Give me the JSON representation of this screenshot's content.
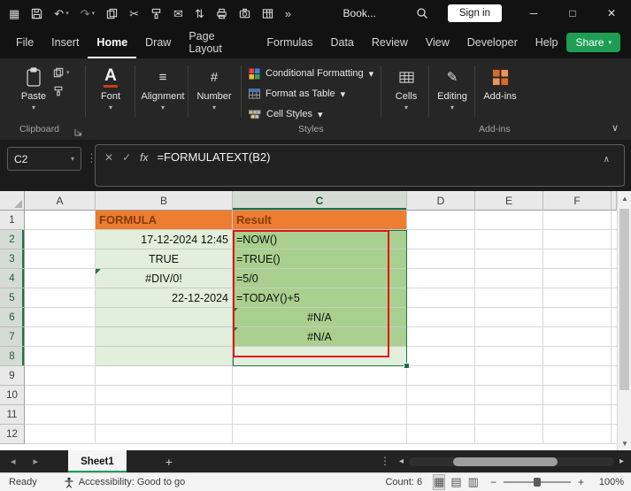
{
  "window": {
    "title": "Book...",
    "signin_label": "Sign in"
  },
  "icons": {
    "app_grid": "▦",
    "undo": "↶",
    "redo": "↷",
    "cut": "✂",
    "mail": "✉",
    "sort": "⇅",
    "overflow": "»",
    "caret": "▾",
    "collapse_ribbon": "∨",
    "expand_formula": "∧",
    "cancel": "✕",
    "enter": "✓",
    "fx": "fx",
    "drag_handle": "⋮",
    "align": "≡",
    "number_sign": "#",
    "editing_pencil": "✎",
    "font_letter": "A",
    "minimize": "─",
    "maximize": "□",
    "close": "✕",
    "tab_prev": "◂",
    "tab_next": "▸",
    "add_sheet": "+",
    "more": "⋮",
    "scroll_up": "▲",
    "scroll_down": "▼",
    "scroll_left": "◂",
    "scroll_right": "▸",
    "view_normal": "▦",
    "view_layout": "▤",
    "view_break": "▥",
    "zoom_out": "−",
    "zoom_in": "+"
  },
  "menubar": {
    "tabs": [
      "File",
      "Insert",
      "Home",
      "Draw",
      "Page Layout",
      "Formulas",
      "Data",
      "Review",
      "View",
      "Developer",
      "Help"
    ],
    "active_tab": "Home",
    "share_label": "Share"
  },
  "ribbon": {
    "paste_label": "Paste",
    "font_label": "Font",
    "alignment_label": "Alignment",
    "number_label": "Number",
    "conditional_formatting_label": "Conditional Formatting",
    "format_as_table_label": "Format as Table",
    "cell_styles_label": "Cell Styles",
    "cells_label": "Cells",
    "editing_label": "Editing",
    "addins_label": "Add-ins",
    "clipboard_group_label": "Clipboard",
    "styles_group_label": "Styles",
    "addins_group_label": "Add-ins"
  },
  "formula_bar": {
    "name_box": "C2",
    "formula": "=FORMULATEXT(B2)"
  },
  "grid": {
    "columns": [
      "A",
      "B",
      "C",
      "D",
      "E",
      "F"
    ],
    "rows": [
      "1",
      "2",
      "3",
      "4",
      "5",
      "6",
      "7",
      "8",
      "9",
      "10",
      "11",
      "12"
    ],
    "cells": {
      "B1": "FORMULA",
      "C1": "Result",
      "B2": "17-12-2024 12:45",
      "B3": "TRUE",
      "B4": "#DIV/0!",
      "B5": "22-12-2024",
      "C2": "=NOW()",
      "C3": "=TRUE()",
      "C4": "=5/0",
      "C5": "=TODAY()+5",
      "C6": "#N/A",
      "C7": "#N/A"
    }
  },
  "sheet_tabs": {
    "active_sheet": "Sheet1"
  },
  "status_bar": {
    "mode": "Ready",
    "accessibility": "Accessibility: Good to go",
    "count": "Count: 6",
    "zoom": "100%"
  },
  "colors": {
    "header_fill": "#ED7D31",
    "header_text": "#843C0C",
    "light_green_fill": "#E2EFDA",
    "medium_green_fill": "#A9D08E",
    "annotation_red": "#E21414",
    "selection_green": "#1E7145",
    "share_green": "#1E9E54",
    "addins_orange": "#D86A2A"
  }
}
